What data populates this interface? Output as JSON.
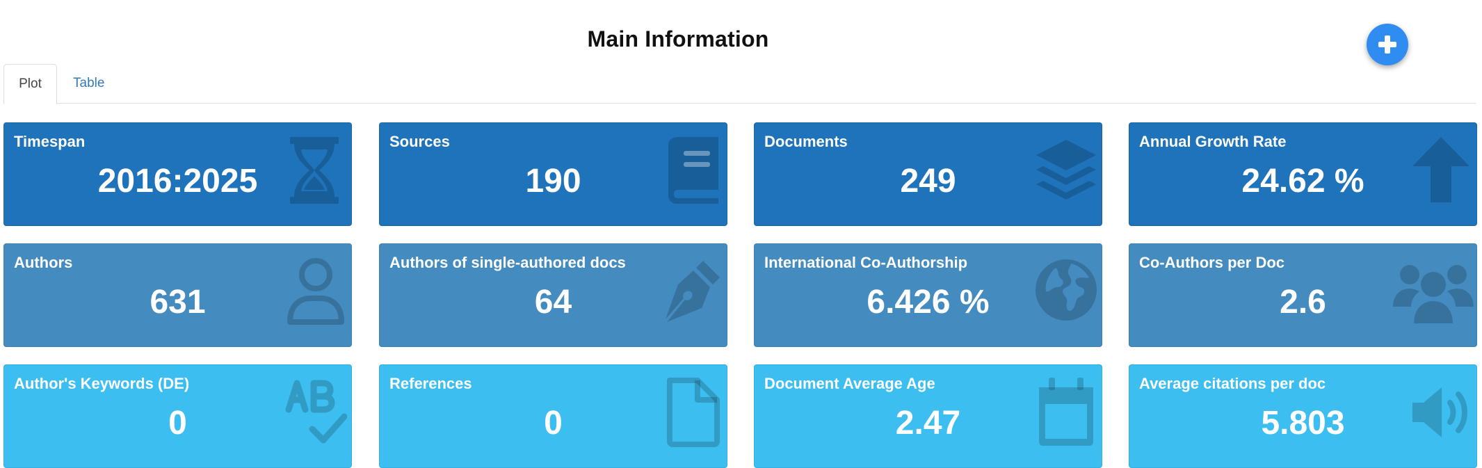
{
  "header": {
    "title": "Main Information"
  },
  "add_button": {
    "icon": "plus-icon"
  },
  "tabs": [
    {
      "label": "Plot",
      "active": true
    },
    {
      "label": "Table",
      "active": false
    }
  ],
  "colors": {
    "row1": "#1e73bb",
    "row2": "#448bc0",
    "row3": "#3cbef0",
    "add_button": "#2f8cf0",
    "tab_link": "#337ab7"
  },
  "cards": [
    {
      "label": "Timespan",
      "value": "2016:2025",
      "icon": "hourglass-icon"
    },
    {
      "label": "Sources",
      "value": "190",
      "icon": "book-icon"
    },
    {
      "label": "Documents",
      "value": "249",
      "icon": "layers-icon"
    },
    {
      "label": "Annual Growth Rate",
      "value": "24.62 %",
      "icon": "arrow-up-icon"
    },
    {
      "label": "Authors",
      "value": "631",
      "icon": "user-icon"
    },
    {
      "label": "Authors of single-authored docs",
      "value": "64",
      "icon": "pen-nib-icon"
    },
    {
      "label": "International Co-Authorship",
      "value": "6.426 %",
      "icon": "globe-icon"
    },
    {
      "label": "Co-Authors per Doc",
      "value": "2.6",
      "icon": "users-icon"
    },
    {
      "label": "Author's Keywords (DE)",
      "value": "0",
      "icon": "spell-check-icon"
    },
    {
      "label": "References",
      "value": "0",
      "icon": "file-icon"
    },
    {
      "label": "Document Average Age",
      "value": "2.47",
      "icon": "calendar-icon"
    },
    {
      "label": "Average citations per doc",
      "value": "5.803",
      "icon": "volume-icon"
    }
  ]
}
